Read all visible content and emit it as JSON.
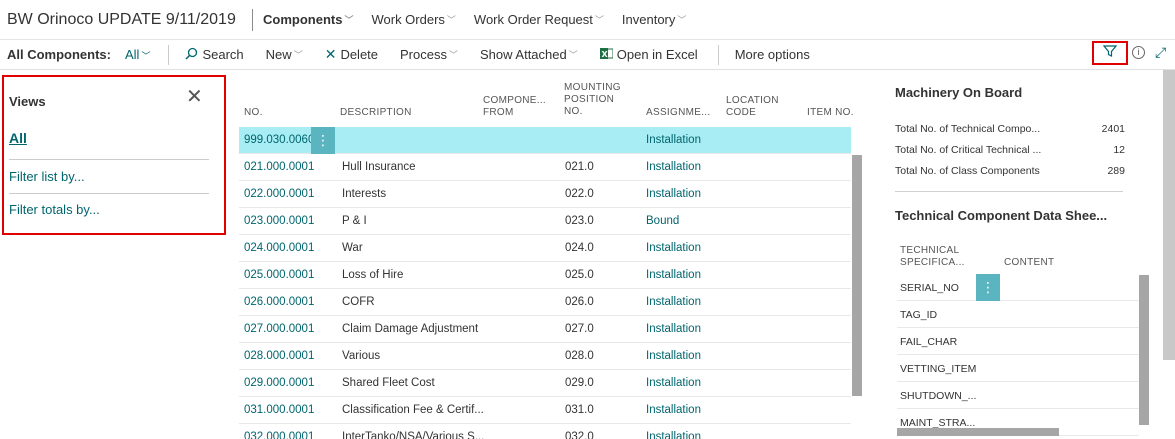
{
  "header": {
    "company": "BW Orinoco UPDATE 9/11/2019",
    "nav": [
      {
        "label": "Components",
        "active": true
      },
      {
        "label": "Work Orders",
        "active": false
      },
      {
        "label": "Work Order Request",
        "active": false
      },
      {
        "label": "Inventory",
        "active": false
      }
    ]
  },
  "actionbar": {
    "caption": "All Components:",
    "view": "All",
    "search": "Search",
    "new": "New",
    "delete": "Delete",
    "process": "Process",
    "show_attached": "Show Attached",
    "open_excel": "Open in Excel",
    "more": "More options"
  },
  "views": {
    "title": "Views",
    "all": "All",
    "filter_list": "Filter list by...",
    "filter_totals": "Filter totals by..."
  },
  "list": {
    "columns": {
      "no": "NO.",
      "description": "DESCRIPTION",
      "component_from": "COMPONE... FROM",
      "mounting_position": "MOUNTING POSITION NO.",
      "assignment": "ASSIGNME...",
      "location_code": "LOCATION CODE",
      "item_no": "ITEM NO."
    },
    "rows": [
      {
        "no": "999.030.0060",
        "description": "",
        "mounting": "",
        "assignment": "Installation",
        "selected": true
      },
      {
        "no": "021.000.0001",
        "description": "Hull Insurance",
        "mounting": "021.0",
        "assignment": "Installation"
      },
      {
        "no": "022.000.0001",
        "description": "Interests",
        "mounting": "022.0",
        "assignment": "Installation"
      },
      {
        "no": "023.000.0001",
        "description": "P & I",
        "mounting": "023.0",
        "assignment": "Bound"
      },
      {
        "no": "024.000.0001",
        "description": "War",
        "mounting": "024.0",
        "assignment": "Installation"
      },
      {
        "no": "025.000.0001",
        "description": "Loss of Hire",
        "mounting": "025.0",
        "assignment": "Installation"
      },
      {
        "no": "026.000.0001",
        "description": "COFR",
        "mounting": "026.0",
        "assignment": "Installation"
      },
      {
        "no": "027.000.0001",
        "description": "Claim Damage Adjustment",
        "mounting": "027.0",
        "assignment": "Installation"
      },
      {
        "no": "028.000.0001",
        "description": "Various",
        "mounting": "028.0",
        "assignment": "Installation"
      },
      {
        "no": "029.000.0001",
        "description": "Shared Fleet Cost",
        "mounting": "029.0",
        "assignment": "Installation"
      },
      {
        "no": "031.000.0001",
        "description": "Classification Fee & Certif...",
        "mounting": "031.0",
        "assignment": "Installation"
      },
      {
        "no": "032.000.0001",
        "description": "InterTanko/NSA/Various S...",
        "mounting": "032.0",
        "assignment": "Installation"
      }
    ]
  },
  "factbox": {
    "machinery_title": "Machinery On Board",
    "cues": [
      {
        "label": "Total No. of Technical Compo...",
        "value": "2401"
      },
      {
        "label": "Total No. of Critical Technical ...",
        "value": "12"
      },
      {
        "label": "Total No. of Class Components",
        "value": "289"
      }
    ],
    "tcd_title": "Technical Component Data Shee...",
    "tcd_col_spec": "TECHNICAL SPECIFICA...",
    "tcd_col_content": "CONTENT",
    "tcd_rows": [
      "SERIAL_NO",
      "TAG_ID",
      "FAIL_CHAR",
      "VETTING_ITEM",
      "SHUTDOWN_...",
      "MAINT_STRA..."
    ]
  }
}
